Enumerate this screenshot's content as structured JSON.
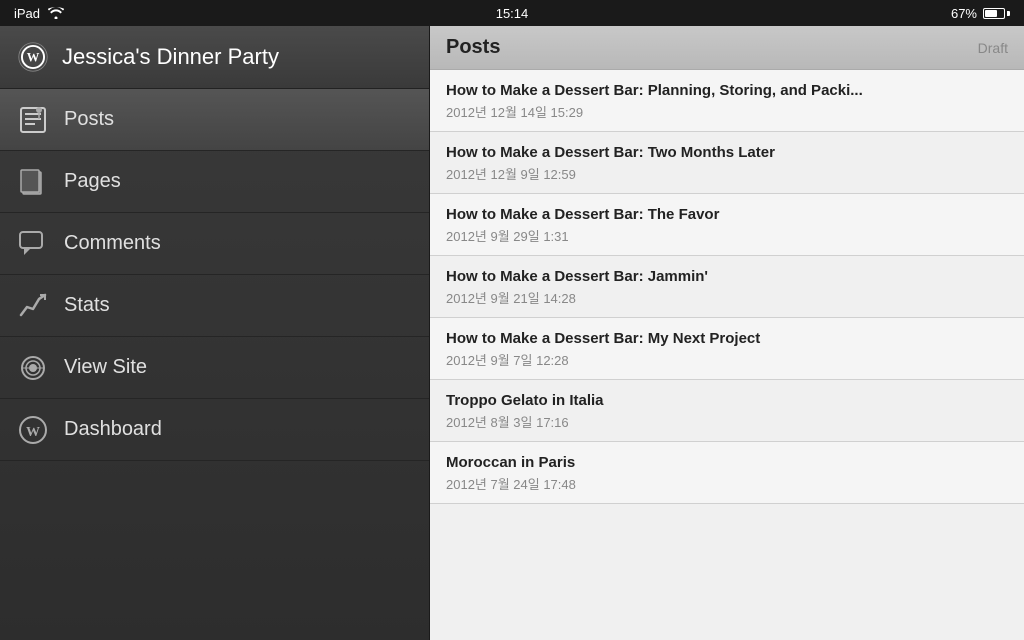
{
  "statusBar": {
    "left": "iPad",
    "time": "15:14",
    "battery": "67%"
  },
  "sidebar": {
    "siteTitle": "Jessica's Dinner Party",
    "navItems": [
      {
        "id": "posts",
        "label": "Posts",
        "active": true
      },
      {
        "id": "pages",
        "label": "Pages",
        "active": false
      },
      {
        "id": "comments",
        "label": "Comments",
        "active": false
      },
      {
        "id": "stats",
        "label": "Stats",
        "active": false
      },
      {
        "id": "viewsite",
        "label": "View Site",
        "active": false
      },
      {
        "id": "dashboard",
        "label": "Dashboard",
        "active": false
      }
    ]
  },
  "content": {
    "title": "Posts",
    "draftLabel": "Draft",
    "posts": [
      {
        "title": "How to Make a Dessert Bar: Planning, Storing, and Packi...",
        "date": "2012년 12월 14일 15:29"
      },
      {
        "title": "How to Make a Dessert Bar: Two Months Later",
        "date": "2012년 12월 9일 12:59"
      },
      {
        "title": "How to Make a Dessert Bar: The Favor",
        "date": "2012년 9월 29일 1:31"
      },
      {
        "title": "How to Make a Dessert Bar: Jammin'",
        "date": "2012년 9월 21일 14:28"
      },
      {
        "title": "How to Make a Dessert Bar: My Next Project",
        "date": "2012년 9월 7일 12:28"
      },
      {
        "title": "Troppo Gelato in Italia",
        "date": "2012년 8월 3일 17:16"
      },
      {
        "title": "Moroccan in Paris",
        "date": "2012년 7월 24일 17:48"
      }
    ]
  }
}
